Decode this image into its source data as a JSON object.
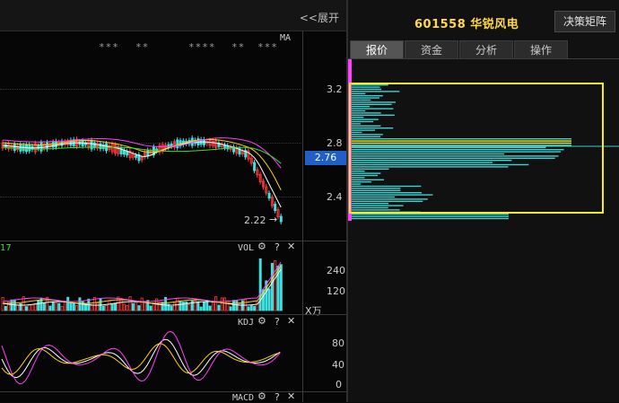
{
  "header": {
    "expand_label": "<<展开"
  },
  "stock": {
    "code_name": "601558 华锐风电",
    "decision_button": "决策矩阵"
  },
  "tabs": [
    {
      "label": "报价",
      "active": true
    },
    {
      "label": "资金",
      "active": false
    },
    {
      "label": "分析",
      "active": false
    },
    {
      "label": "操作",
      "active": false
    }
  ],
  "main_chart": {
    "ma_label": "MA",
    "stars": [
      "***",
      "**",
      "****",
      "**",
      "***"
    ],
    "price_ticks": [
      "3.2",
      "2.8",
      "2.4"
    ],
    "current_price": "2.76",
    "low_annotation": "2.22"
  },
  "volume_panel": {
    "title": "VOL",
    "left_fragment": "17",
    "ticks": [
      "240",
      "120"
    ],
    "unit": "X万"
  },
  "kdj_panel": {
    "title": "KDJ",
    "ticks": [
      "80",
      "40",
      "0"
    ]
  },
  "macd_panel": {
    "title": "MACD"
  },
  "colors": {
    "up": "#ff3b3b",
    "down": "#3fe0e0",
    "ma5": "#ffffff",
    "ma10": "#ffd400",
    "ma20": "#ff40ff",
    "ma60": "#3cdc3c",
    "chip_box": "#f4ef1a",
    "chip_bar": "#3fd0d0"
  }
}
